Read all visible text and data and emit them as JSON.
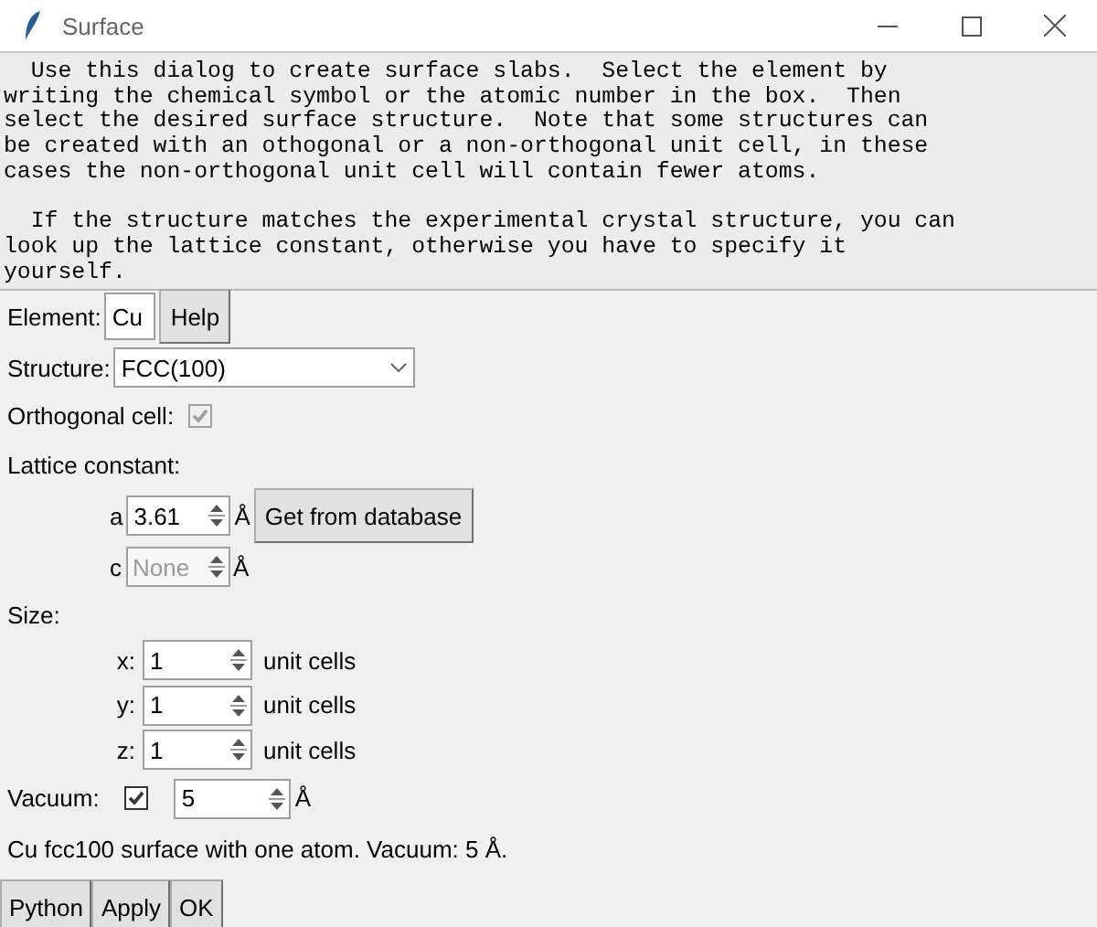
{
  "window": {
    "title": "Surface"
  },
  "description": "  Use this dialog to create surface slabs.  Select the element by\nwriting the chemical symbol or the atomic number in the box.  Then\nselect the desired surface structure.  Note that some structures can\nbe created with an othogonal or a non-orthogonal unit cell, in these\ncases the non-orthogonal unit cell will contain fewer atoms.\n\n  If the structure matches the experimental crystal structure, you can\nlook up the lattice constant, otherwise you have to specify it\nyourself.",
  "element": {
    "label": "Element:",
    "value": "Cu",
    "help_button": "Help"
  },
  "structure": {
    "label": "Structure:",
    "value": "FCC(100)"
  },
  "orthogonal": {
    "label": "Orthogonal cell:",
    "checked": true,
    "disabled": true
  },
  "lattice": {
    "label": "Lattice constant:",
    "params": [
      {
        "name": "a",
        "value": "3.61",
        "unit": "Å",
        "disabled": false,
        "button": "Get from database"
      },
      {
        "name": "c",
        "value": "None",
        "unit": "Å",
        "disabled": true
      }
    ]
  },
  "size": {
    "label": "Size:",
    "axes": [
      {
        "name": "x:",
        "value": "1",
        "unit": "unit cells"
      },
      {
        "name": "y:",
        "value": "1",
        "unit": "unit cells"
      },
      {
        "name": "z:",
        "value": "1",
        "unit": "unit cells"
      }
    ]
  },
  "vacuum": {
    "label": "Vacuum:",
    "checked": true,
    "disabled": false,
    "value": "5",
    "unit": "Å"
  },
  "summary": "Cu fcc100 surface with one atom. Vacuum: 5 Å.",
  "buttons": [
    "Python",
    "Apply",
    "OK"
  ]
}
